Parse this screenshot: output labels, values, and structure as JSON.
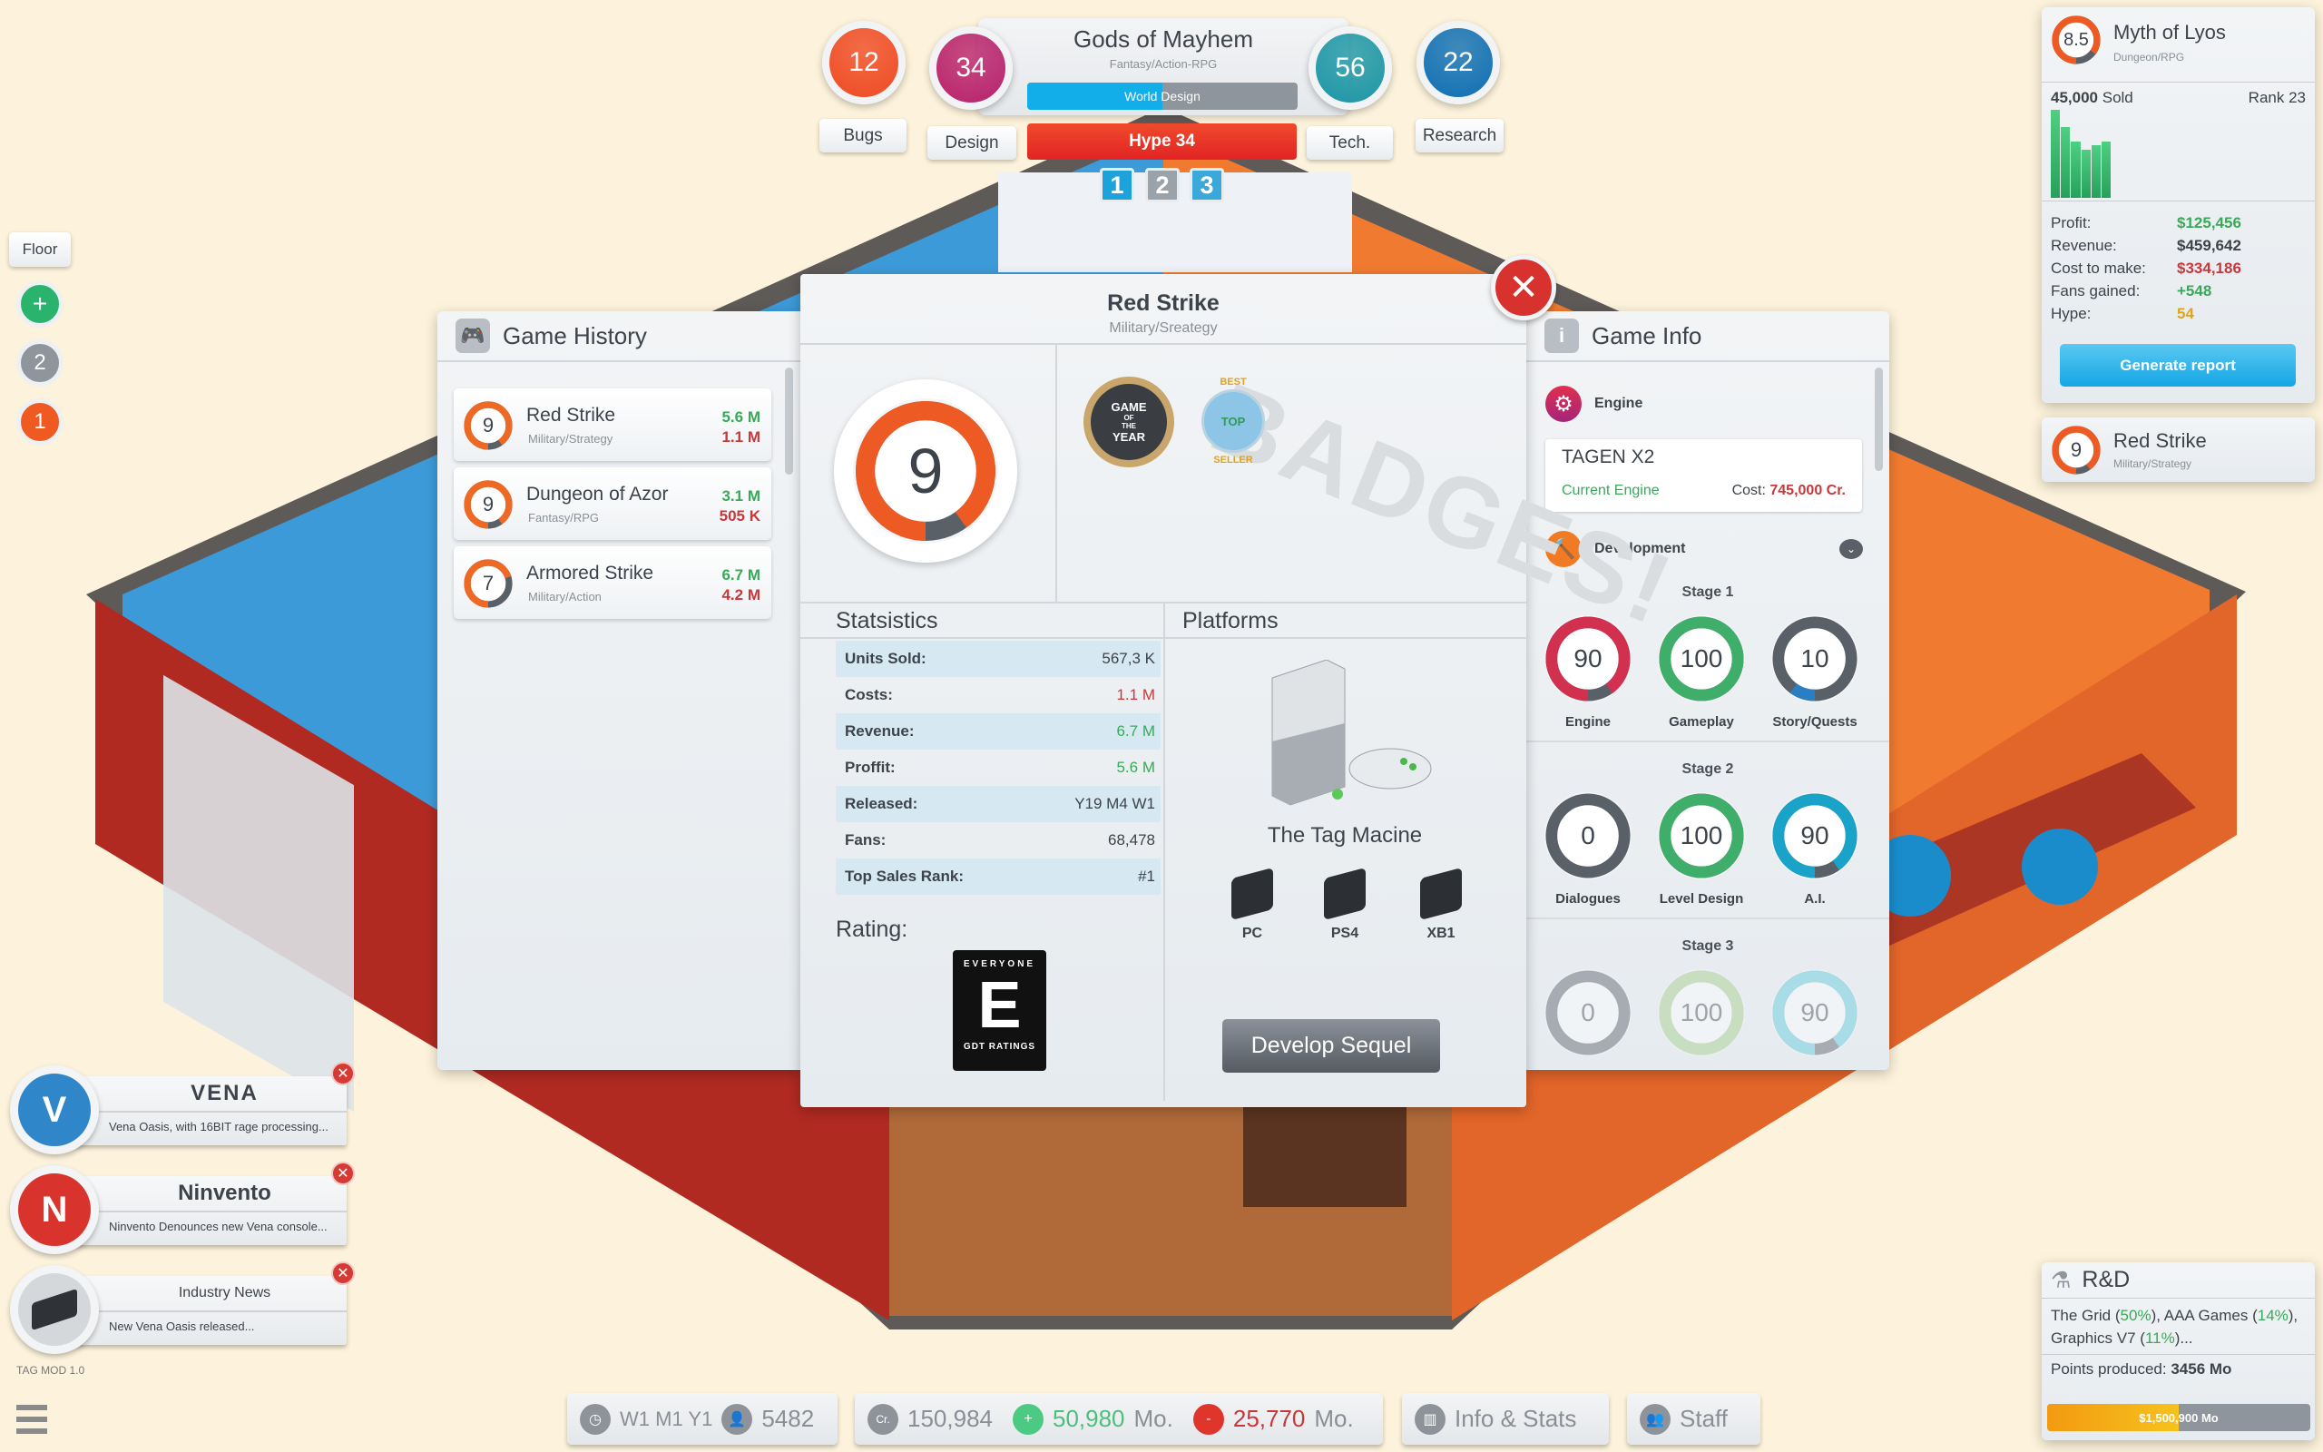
{
  "colors": {
    "accent_blue": "#1ba8e6",
    "hype_red": "#e8302a",
    "green": "#3aa85a",
    "red": "#c8383a",
    "yellow": "#e2a31c"
  },
  "top_hud": {
    "current_game": {
      "title": "Gods of Mayhem",
      "genre": "Fantasy/Action-RPG",
      "phase": "World Design",
      "phase_progress": 0.5,
      "hype_label": "Hype 34"
    },
    "stats": [
      {
        "label": "Bugs",
        "value": "12",
        "color": "#ef4a22"
      },
      {
        "label": "Design",
        "value": "34",
        "color": "#b8226b"
      },
      {
        "label": "Tech.",
        "value": "56",
        "color": "#1c96a6"
      },
      {
        "label": "Research",
        "value": "22",
        "color": "#0f6fb3"
      }
    ],
    "pages": [
      "1",
      "2",
      "3"
    ],
    "active_page": "1"
  },
  "floor": {
    "label": "Floor",
    "add_icon": "plus-icon",
    "floors": [
      "2",
      "1"
    ]
  },
  "game_history": {
    "title": "Game History",
    "icon": "gamepad-icon",
    "items": [
      {
        "score": 9,
        "name": "Red Strike",
        "genre": "Military/Strategy",
        "profit": "5.6 M",
        "cost": "1.1 M"
      },
      {
        "score": 9,
        "name": "Dungeon of Azor",
        "genre": "Fantasy/RPG",
        "profit": "3.1 M",
        "cost": "505 K"
      },
      {
        "score": 7,
        "name": "Armored Strike",
        "genre": "Military/Action",
        "profit": "6.7 M",
        "cost": "4.2 M"
      }
    ]
  },
  "game_detail": {
    "title": "Red Strike",
    "genre": "Military/Sreategy",
    "score": 9,
    "badges": [
      {
        "name": "game-of-the-year",
        "text": [
          "GAME",
          "OF",
          "THE",
          "YEAR"
        ]
      },
      {
        "name": "best-seller",
        "text": [
          "BEST",
          "TOP",
          "SELLER"
        ]
      }
    ],
    "watermark": "BADGES!",
    "stats_title": "Statsistics",
    "stats": [
      {
        "label": "Units Sold:",
        "value": "567,3 K",
        "tone": "neutral"
      },
      {
        "label": "Costs:",
        "value": "1.1 M",
        "tone": "red"
      },
      {
        "label": "Revenue:",
        "value": "6.7 M",
        "tone": "green"
      },
      {
        "label": "Proffit:",
        "value": "5.6 M",
        "tone": "green"
      },
      {
        "label": "Released:",
        "value": "Y19 M4 W1",
        "tone": "neutral"
      },
      {
        "label": "Fans:",
        "value": "68,478",
        "tone": "neutral"
      },
      {
        "label": "Top Sales Rank:",
        "value": "#1",
        "tone": "neutral"
      }
    ],
    "rating_label": "Rating:",
    "rating_badge": {
      "top": "EVERYONE",
      "letter": "E",
      "bottom": "GDT RATINGS"
    },
    "platforms_title": "Platforms",
    "main_platform": "The Tag Macine",
    "platforms": [
      "PC",
      "PS4",
      "XB1"
    ],
    "sequel_button": "Develop Sequel"
  },
  "game_info": {
    "title": "Game Info",
    "icon": "info-icon",
    "engine_label": "Engine",
    "engine": {
      "name": "TAGEN X2",
      "status": "Current Engine",
      "cost_label": "Cost:",
      "cost": "745,000 Cr."
    },
    "development_label": "Development",
    "stages": [
      {
        "label": "Stage 1",
        "items": [
          {
            "label": "Engine",
            "value": 90,
            "color": "#d2304f"
          },
          {
            "label": "Gameplay",
            "value": 100,
            "color": "#3fae6a"
          },
          {
            "label": "Story/Quests",
            "value": 10,
            "color": "#2a7fc4"
          }
        ]
      },
      {
        "label": "Stage 2",
        "items": [
          {
            "label": "Dialogues",
            "value": 0,
            "color": "#5a6068"
          },
          {
            "label": "Level Design",
            "value": 100,
            "color": "#3fae6a"
          },
          {
            "label": "A.I.",
            "value": 90,
            "color": "#1aa3c8"
          }
        ]
      },
      {
        "label": "Stage 3",
        "items": [
          {
            "label": "",
            "value": 0,
            "color": "#9aa0a6"
          },
          {
            "label": "",
            "value": 100,
            "color": "#a5cf8a"
          },
          {
            "label": "",
            "value": 90,
            "color": "#5cc9dc"
          }
        ]
      }
    ]
  },
  "market_card": {
    "score": "8.5",
    "title": "Myth of Lyos",
    "genre": "Dungeon/RPG",
    "sold_value": "45,000",
    "sold_label": "Sold",
    "rank": "Rank 23",
    "sales_bars": [
      100,
      80,
      64,
      55,
      60,
      64
    ],
    "rows": [
      {
        "label": "Profit:",
        "value": "$125,456",
        "tone": "green"
      },
      {
        "label": "Revenue:",
        "value": "$459,642",
        "tone": "neutral"
      },
      {
        "label": "Cost to make:",
        "value": "$334,186",
        "tone": "red"
      },
      {
        "label": "Fans gained:",
        "value": "+548",
        "tone": "green"
      },
      {
        "label": "Hype:",
        "value": "54",
        "tone": "yellow"
      }
    ],
    "button": "Generate report"
  },
  "mini_card": {
    "score": 9,
    "title": "Red Strike",
    "genre": "Military/Strategy"
  },
  "rnd": {
    "title": "R&D",
    "projects": [
      {
        "name": "The Grid",
        "pct": "50%"
      },
      {
        "name": "AAA Games",
        "pct": "14%"
      },
      {
        "name": "Graphics V7",
        "pct": "11%"
      }
    ],
    "points_label": "Points produced:",
    "points": "3456 Mo",
    "bar_label": "$1,500,900 Mo",
    "bar_progress": 0.5
  },
  "notifications": [
    {
      "brand": "VENA",
      "letter": "V",
      "color": "#2f86c9",
      "text": "Vena Oasis, with 16BIT rage processing..."
    },
    {
      "brand": "Ninvento",
      "letter": "N",
      "color": "#d8332c",
      "text": "Ninvento Denounces new Vena console..."
    },
    {
      "brand": "Industry News",
      "letter": "",
      "color": "#d5d8db",
      "text": "New Vena Oasis released..."
    }
  ],
  "version": "TAG MOD 1.0",
  "bottom_bar": {
    "date": "W1 M1 Y1",
    "fans": "5482",
    "credits": "150,984",
    "income": "50,980",
    "income_unit": "Mo.",
    "expense": "25,770",
    "expense_unit": "Mo.",
    "info_button": "Info & Stats",
    "staff_button": "Staff"
  }
}
